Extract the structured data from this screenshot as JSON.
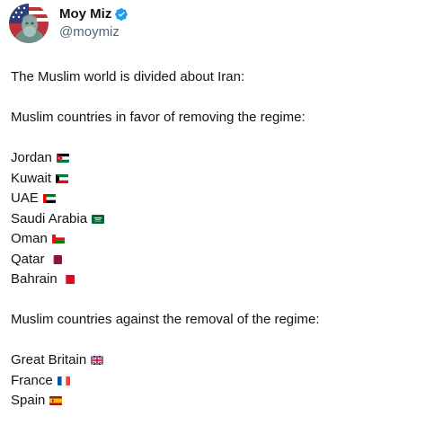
{
  "author": {
    "display_name": "Moy Miz",
    "handle": "@moymiz",
    "verified_color": "#1d9bf0"
  },
  "tweet": {
    "intro": "The Muslim world is divided about Iran:",
    "favor_heading": "Muslim countries in favor of removing the regime:",
    "favor_countries": [
      {
        "name": "Jordan",
        "flag": "jordan-flag-icon"
      },
      {
        "name": "Kuwait",
        "flag": "kuwait-flag-icon"
      },
      {
        "name": "UAE",
        "flag": "uae-flag-icon"
      },
      {
        "name": "Saudi Arabia",
        "flag": "saudi-arabia-flag-icon"
      },
      {
        "name": "Oman",
        "flag": "oman-flag-icon"
      },
      {
        "name": "Qatar",
        "flag": "qatar-flag-icon"
      },
      {
        "name": "Bahrain",
        "flag": "bahrain-flag-icon"
      }
    ],
    "against_heading": "Muslim countries against the removal of the regime:",
    "against_countries": [
      {
        "name": "Great Britain",
        "flag": "united-kingdom-flag-icon"
      },
      {
        "name": "France",
        "flag": "france-flag-icon"
      },
      {
        "name": "Spain",
        "flag": "spain-flag-icon"
      }
    ]
  },
  "colors": {
    "text": "#0f1419",
    "secondary_text": "#536471",
    "verified_badge": "#1d9bf0"
  }
}
